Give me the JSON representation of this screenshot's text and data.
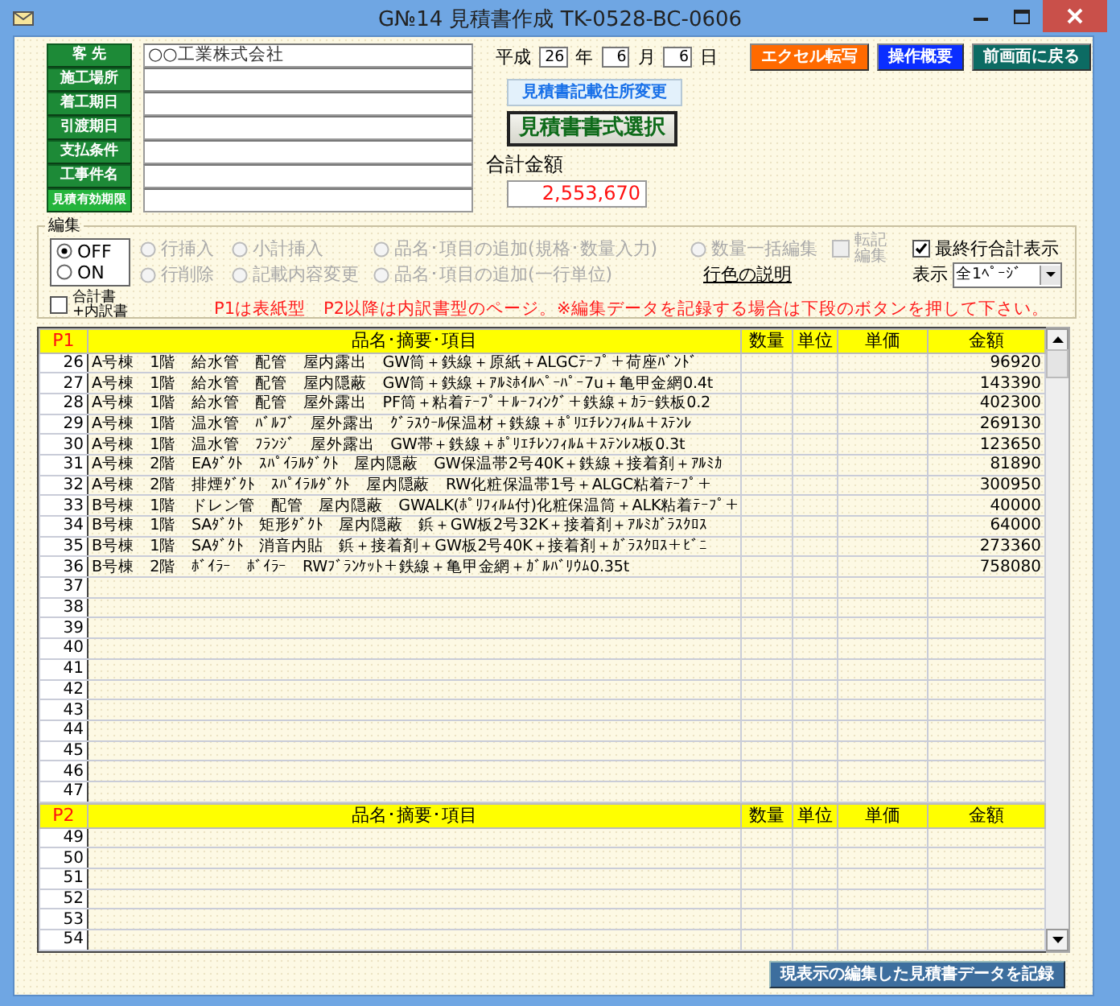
{
  "window": {
    "title": "G№14 見積書作成  TK-0528-BC-0606"
  },
  "fields": [
    {
      "label": "客 先",
      "value": "○○工業株式会社"
    },
    {
      "label": "施工場所"
    },
    {
      "label": "着工期日"
    },
    {
      "label": "引渡期日"
    },
    {
      "label": "支払条件"
    },
    {
      "label": "工事件名"
    },
    {
      "label": "見積有効期限"
    }
  ],
  "date": {
    "era": "平成",
    "year": "26",
    "year_unit": "年",
    "month": "6",
    "month_unit": "月",
    "day": "6",
    "day_unit": "日"
  },
  "top_buttons": [
    {
      "label": "エクセル転写",
      "color": "#ff6a00"
    },
    {
      "label": "操作概要",
      "color": "#0a2eff"
    },
    {
      "label": "前画面に戻る",
      "color": "#0c6b63"
    }
  ],
  "address_button": "見積書記載住所変更",
  "format_button": "見積書書式選択",
  "total": {
    "label": "合計金額",
    "value": "2,553,670"
  },
  "edit": {
    "title": "編集",
    "mode": [
      {
        "label": "OFF",
        "selected": true
      },
      {
        "label": "ON",
        "selected": false
      }
    ],
    "options": [
      {
        "label": "行挿入",
        "disabled": true
      },
      {
        "label": "小計挿入",
        "disabled": true
      },
      {
        "label": "品名･項目の追加(規格･数量入力)",
        "disabled": true
      },
      {
        "label": "数量一括編集",
        "disabled": true
      },
      {
        "label": "行削除",
        "disabled": true
      },
      {
        "label": "記載内容変更",
        "disabled": true
      },
      {
        "label": "品名･項目の追加(一行単位)",
        "disabled": true
      }
    ],
    "transfer_checkbox": {
      "label": "転記編集",
      "checked": false,
      "disabled": true
    },
    "color_legend_link": "行色の説明",
    "last_row_total": {
      "label": "最終行合計表示",
      "checked": true
    },
    "display": {
      "label": "表示",
      "value": "全1ﾍﾟｰｼﾞ"
    },
    "summary_checkbox": {
      "label": "合計書+内訳書",
      "checked": false
    },
    "note": "P1は表紙型　P2以降は内訳書型のページ。※編集データを記録する場合は下段のボタンを押して下さい。"
  },
  "pages": [
    {
      "page": "P1",
      "columns": [
        "品名･摘要･項目",
        "数量",
        "単位",
        "単価",
        "金額"
      ],
      "rows": [
        {
          "no": "26",
          "item": "A号棟　1階　給水管　配管　屋内露出　GW筒＋鉄線＋原紙＋ALGCﾃｰﾌﾟ＋荷座ﾊﾞﾝﾄﾞ",
          "amount": "96920"
        },
        {
          "no": "27",
          "item": "A号棟　1階　給水管　配管　屋内隠蔽　GW筒＋鉄線＋ｱﾙﾐﾎｲﾙﾍﾟｰﾊﾟｰ7u＋亀甲金網0.4t",
          "amount": "143390"
        },
        {
          "no": "28",
          "item": "A号棟　1階　給水管　配管　屋外露出　PF筒＋粘着ﾃｰﾌﾟ＋ﾙｰﾌｨﾝｸﾞ＋鉄線＋ｶﾗｰ鉄板0.2",
          "amount": "402300"
        },
        {
          "no": "29",
          "item": "A号棟　1階　温水管　ﾊﾞﾙﾌﾞ　屋外露出　ｸﾞﾗｽｳｰﾙ保温材＋鉄線＋ﾎﾟﾘｴﾁﾚﾝﾌｨﾙﾑ＋ｽﾃﾝﾚ",
          "amount": "269130"
        },
        {
          "no": "30",
          "item": "A号棟　1階　温水管　ﾌﾗﾝｼﾞ　屋外露出　GW帯＋鉄線＋ﾎﾟﾘｴﾁﾚﾝﾌｨﾙﾑ＋ｽﾃﾝﾚｽ板0.3t",
          "amount": "123650"
        },
        {
          "no": "31",
          "item": "A号棟　2階　EAﾀﾞｸﾄ　ｽﾊﾟｲﾗﾙﾀﾞｸﾄ　屋内隠蔽　GW保温帯2号40K＋鉄線＋接着剤＋ｱﾙﾐｶ",
          "amount": "81890"
        },
        {
          "no": "32",
          "item": "A号棟　2階　排煙ﾀﾞｸﾄ　ｽﾊﾟｲﾗﾙﾀﾞｸﾄ　屋内隠蔽　RW化粧保温帯1号＋ALGC粘着ﾃｰﾌﾟ＋",
          "amount": "300950"
        },
        {
          "no": "33",
          "item": "B号棟　1階　ドレン管　配管　屋内隠蔽　GWALK(ﾎﾟﾘﾌｨﾙﾑ付)化粧保温筒＋ALK粘着ﾃｰﾌﾟ＋",
          "amount": "40000"
        },
        {
          "no": "34",
          "item": "B号棟　1階　SAﾀﾞｸﾄ　矩形ﾀﾞｸﾄ　屋内隠蔽　鋲＋GW板2号32K＋接着剤＋ｱﾙﾐｶﾞﾗｽｸﾛｽ",
          "amount": "64000"
        },
        {
          "no": "35",
          "item": "B号棟　1階　SAﾀﾞｸﾄ　消音内貼　鋲＋接着剤＋GW板2号40K＋接着剤＋ｶﾞﾗｽｸﾛｽ＋ﾋﾞﾆ",
          "amount": "273360"
        },
        {
          "no": "36",
          "item": "B号棟　2階　ﾎﾞｲﾗｰ　ﾎﾞｲﾗｰ　RWﾌﾞﾗﾝｹｯﾄ＋鉄線＋亀甲金網＋ｶﾞﾙﾊﾞﾘｳﾑ0.35t",
          "amount": "758080"
        },
        {
          "no": "37"
        },
        {
          "no": "38"
        },
        {
          "no": "39"
        },
        {
          "no": "40"
        },
        {
          "no": "41"
        },
        {
          "no": "42"
        },
        {
          "no": "43"
        },
        {
          "no": "44"
        },
        {
          "no": "45"
        },
        {
          "no": "46"
        },
        {
          "no": "47"
        }
      ]
    },
    {
      "page": "P2",
      "columns": [
        "品名･摘要･項目",
        "数量",
        "単位",
        "単価",
        "金額"
      ],
      "rows": [
        {
          "no": "49"
        },
        {
          "no": "50"
        },
        {
          "no": "51"
        },
        {
          "no": "52"
        },
        {
          "no": "53"
        },
        {
          "no": "54"
        }
      ]
    }
  ],
  "record_button": "現表示の編集した見積書データを記録"
}
